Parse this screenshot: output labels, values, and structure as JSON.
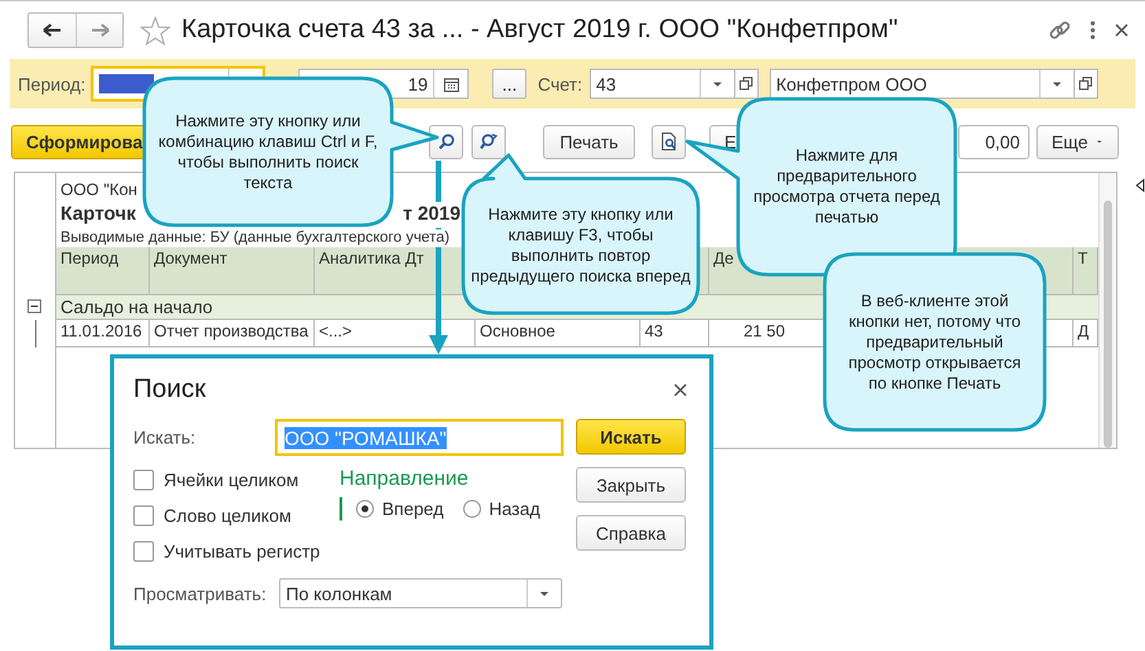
{
  "window": {
    "title": "Карточка счета 43 за ... - Август 2019 г. ООО \"Конфетпром\""
  },
  "filters": {
    "period": {
      "label": "Период:",
      "highlighted": true
    },
    "date": {
      "value": "19"
    },
    "dots_button": "...",
    "account": {
      "label": "Счет:",
      "value": "43"
    },
    "organization": {
      "value": "Конфетпром ООО"
    }
  },
  "toolbar": {
    "generate_button": "Сформирова",
    "print_button": "Печать",
    "partial_button": "Е",
    "amount": "0,00",
    "more_button": "Еще"
  },
  "report": {
    "organization": "ООО \"Кон",
    "title_parts": [
      "Карточк",
      "т 2019"
    ],
    "info": "Выводимые данные:  БУ (данные бухгалтерского учета)",
    "columns": [
      "Период",
      "Документ",
      "Аналитика Дт",
      "",
      "",
      "Де",
      "Т"
    ],
    "group_row": {
      "label": "Сальдо на начало",
      "expanded": true
    },
    "rows": [
      {
        "cells": [
          "11.01.2016",
          "Отчет производства",
          "<...>",
          "Основное",
          "43",
          "21 50",
          "Д"
        ]
      }
    ]
  },
  "callouts": [
    {
      "text": "Нажмите эту кнопку или комбинацию клавиш Ctrl и F, чтобы выполнить поиск текста"
    },
    {
      "text": "Нажмите эту кнопку или клавишу F3, чтобы выполнить повтор предыдущего поиска вперед"
    },
    {
      "text": "Нажмите для предварительного просмотра отчета перед печатью"
    },
    {
      "text": "В веб-клиенте этой кнопки нет, потому что предварительный просмотр открывается по кнопке Печать"
    }
  ],
  "search_dialog": {
    "title": "Поиск",
    "search_label": "Искать:",
    "search_value": "ООО \"РОМАШКА\"",
    "value_selected": true,
    "options": [
      {
        "label": "Ячейки целиком",
        "checked": false
      },
      {
        "label": "Слово целиком",
        "checked": false
      },
      {
        "label": "Учитывать регистр",
        "checked": false
      }
    ],
    "direction": {
      "title": "Направление",
      "options": [
        {
          "label": "Вперед",
          "selected": true
        },
        {
          "label": "Назад",
          "selected": false
        }
      ]
    },
    "view_label": "Просматривать:",
    "view_value": "По колонкам",
    "buttons": [
      {
        "label": "Искать",
        "kind": "default"
      },
      {
        "label": "Закрыть",
        "kind": "normal"
      },
      {
        "label": "Справка",
        "kind": "normal"
      }
    ]
  }
}
